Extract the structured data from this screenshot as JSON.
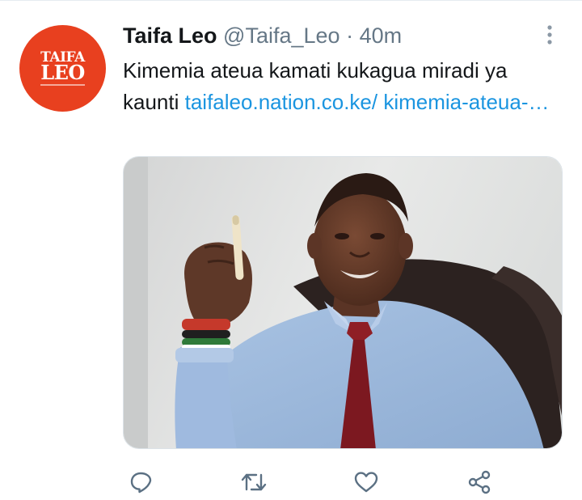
{
  "author": {
    "name": "Taifa Leo",
    "handle": "@Taifa_Leo",
    "separator": "·",
    "time": "40m",
    "avatar_logo_line1": "TAIFA",
    "avatar_logo_line2": "LEO"
  },
  "tweet": {
    "text": "Kimemia ateua kamati kukagua miradi ya kaunti",
    "link": "taifaleo.nation.co.ke/ kimemia-ateua-…"
  },
  "icons": {
    "more": "more-vertical-icon",
    "reply": "reply-icon",
    "retweet": "retweet-icon",
    "like": "heart-icon",
    "share": "share-icon"
  },
  "colors": {
    "avatar_bg": "#e8401f",
    "link": "#1b95e0",
    "text": "#14171a",
    "muted": "#657786"
  }
}
